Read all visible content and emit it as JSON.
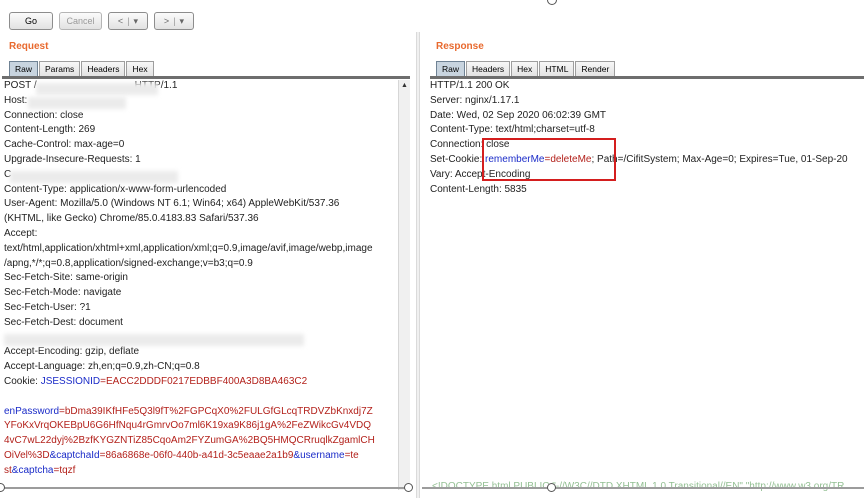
{
  "toolbar": {
    "go_label": "Go",
    "cancel_label": "Cancel",
    "back_label": "<",
    "forward_label": ">",
    "dropdown_glyph": "▾"
  },
  "request": {
    "title": "Request",
    "tabs": [
      "Raw",
      "Params",
      "Headers",
      "Hex"
    ],
    "active_tab": "Raw",
    "lines": [
      "POST /",
      "Host: ",
      "Connection: close",
      "Content-Length: 269",
      "Cache-Control: max-age=0",
      "Upgrade-Insecure-Requests: 1",
      "C",
      "Content-Type: application/x-www-form-urlencoded",
      "User-Agent: Mozilla/5.0 (Windows NT 6.1; Win64; x64) AppleWebKit/537.36",
      "(KHTML, like Gecko) Chrome/85.0.4183.83 Safari/537.36",
      "Accept:",
      "text/html,application/xhtml+xml,application/xml;q=0.9,image/avif,image/webp,image",
      "/apng,*/*;q=0.8,application/signed-exchange;v=b3;q=0.9",
      "Sec-Fetch-Site: same-origin",
      "Sec-Fetch-Mode: navigate",
      "Sec-Fetch-User: ?1",
      "Sec-Fetch-Dest: document",
      "",
      "Accept-Encoding: gzip, deflate",
      "Accept-Language: zh,en;q=0.9,zh-CN;q=0.8"
    ],
    "first_line_suffix": "HTTP/1.1",
    "cookie_label": "Cookie: ",
    "cookie_name": "JSESSIONID",
    "cookie_value": "=EACC2DDDF0217EDBBF400A3D8BA463C2",
    "body_lines": [
      [
        [
          "blue",
          "enPassword"
        ],
        [
          "red",
          "=bDma39IKfHFe5Q3l9fT%2FGPCqX0%2FULGfGLcqTRDVZbKnxdj7Z"
        ]
      ],
      [
        [
          "red",
          "YFoKxVrqOKEBpU6G6HfNqu4rGmrvOo7ml6K19xa9K86j1gA%2FeZWikcGv4VDQ"
        ]
      ],
      [
        [
          "red",
          "4vC7wL22dyj%2BzfKYGZNTiZ85CqoAm2FYZumGA%2BQ5HMQCRruqlkZgamlCH"
        ]
      ],
      [
        [
          "red",
          "OiVel%3D"
        ],
        [
          "blue",
          "&captchaId"
        ],
        [
          "red",
          "=86a6868e-06f0-440b-a41d-3c5eaae2a1b9"
        ],
        [
          "blue",
          "&username"
        ],
        [
          "red",
          "=te"
        ]
      ],
      [
        [
          "red",
          "st"
        ],
        [
          "blue",
          "&captcha"
        ],
        [
          "red",
          "=tqzf"
        ]
      ]
    ]
  },
  "response": {
    "title": "Response",
    "tabs": [
      "Raw",
      "Headers",
      "Hex",
      "HTML",
      "Render"
    ],
    "active_tab": "Raw",
    "lines": [
      "HTTP/1.1 200 OK",
      "Server: nginx/1.17.1",
      "Date: Wed, 02 Sep 2020 06:02:39 GMT",
      "Content-Type: text/html;charset=utf-8",
      "Connection: close"
    ],
    "set_cookie_label": "Set-Cookie: ",
    "set_cookie_name": "rememberMe",
    "set_cookie_value": "=deleteMe",
    "set_cookie_rest": "; Path=/CifitSystem; Max-Age=0; Expires=Tue, 01-Sep-20",
    "after_lines": [
      "Vary: Accept-Encoding",
      "Content-Length: 5835"
    ],
    "faded_bottom": "<!DOCTYPE html PUBLIC \"-//W3C//DTD XHTML 1.0 Transitional//EN\" \"http://www.w3.org/TR"
  },
  "colors": {
    "title_orange": "#e8692e",
    "highlight_red": "#d41e1e",
    "param_blue": "#1a2bc8",
    "value_red": "#b3211b"
  }
}
